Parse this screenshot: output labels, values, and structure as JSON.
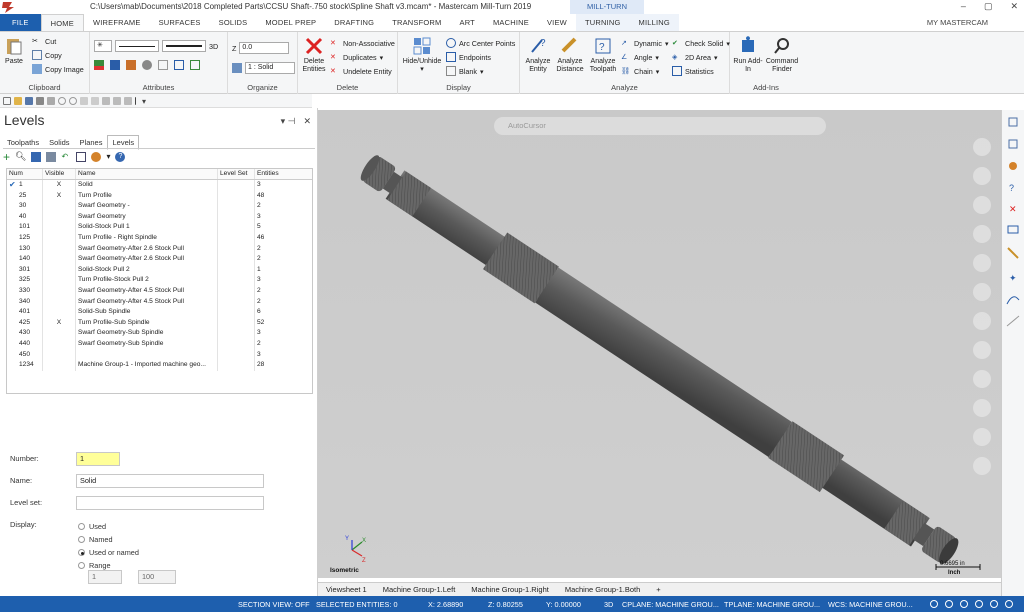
{
  "window": {
    "title": "C:\\Users\\mab\\Documents\\2018 Completed Parts\\CCSU Shaft-.750 stock\\Spline Shaft v3.mcam* - Mastercam Mill-Turn 2019",
    "context_tab": "MILL-TURN"
  },
  "tabs": [
    "FILE",
    "HOME",
    "WIREFRAME",
    "SURFACES",
    "SOLIDS",
    "MODEL PREP",
    "DRAFTING",
    "TRANSFORM",
    "ART",
    "MACHINE",
    "VIEW",
    "TURNING",
    "MILLING"
  ],
  "account": "MY MASTERCAM",
  "ribbon": {
    "clipboard": {
      "paste": "Paste",
      "cut": "Cut",
      "copy": "Copy",
      "copy_image": "Copy Image",
      "label": "Clipboard"
    },
    "attributes": {
      "label": "Attributes",
      "mode": "3D"
    },
    "organize": {
      "label": "Organize",
      "z_label": "Z",
      "z_value": "0.0",
      "level_value": "1 : Solid"
    },
    "delete": {
      "label": "Delete",
      "delete_entities": "Delete Entities",
      "non_assoc": "Non-Associative",
      "duplicates": "Duplicates",
      "undelete": "Undelete Entity"
    },
    "display": {
      "label": "Display",
      "hide": "Hide/Unhide",
      "arc_centers": "Arc Center Points",
      "endpoints": "Endpoints",
      "blank": "Blank"
    },
    "analyze": {
      "label": "Analyze",
      "entity": "Analyze Entity",
      "distance": "Analyze Distance",
      "toolpath": "Analyze Toolpath",
      "dynamic": "Dynamic",
      "angle": "Angle",
      "chain": "Chain",
      "check_solid": "Check Solid",
      "area_2d": "2D Area",
      "statistics": "Statistics"
    },
    "addins": {
      "label": "Add-Ins",
      "run": "Run Add-In",
      "finder": "Command Finder"
    }
  },
  "panel": {
    "title": "Levels",
    "tabs": [
      "Toolpaths",
      "Solids",
      "Planes",
      "Levels"
    ],
    "columns": [
      "Num",
      "Visible",
      "Name",
      "Level Set",
      "Entities"
    ],
    "rows": [
      {
        "num": "1",
        "visible": "X",
        "name": "Solid",
        "set": "",
        "entities": "3",
        "check": "✔"
      },
      {
        "num": "25",
        "visible": "X",
        "name": "Turn Profile",
        "set": "",
        "entities": "48",
        "check": ""
      },
      {
        "num": "30",
        "visible": "",
        "name": "Swarf Geometry -",
        "set": "",
        "entities": "2",
        "check": ""
      },
      {
        "num": "40",
        "visible": "",
        "name": "Swarf Geometry",
        "set": "",
        "entities": "3",
        "check": ""
      },
      {
        "num": "101",
        "visible": "",
        "name": "Solid-Stock Pull 1",
        "set": "",
        "entities": "5",
        "check": ""
      },
      {
        "num": "125",
        "visible": "",
        "name": "Turn Profile - Right Spindle",
        "set": "",
        "entities": "46",
        "check": ""
      },
      {
        "num": "130",
        "visible": "",
        "name": "Swarf Geometry-After 2.6 Stock Pull",
        "set": "",
        "entities": "2",
        "check": ""
      },
      {
        "num": "140",
        "visible": "",
        "name": "Swarf Geometry-After 2.6 Stock Pull",
        "set": "",
        "entities": "2",
        "check": ""
      },
      {
        "num": "301",
        "visible": "",
        "name": "Solid-Stock Pull 2",
        "set": "",
        "entities": "1",
        "check": ""
      },
      {
        "num": "325",
        "visible": "",
        "name": "Turn Profile-Stock Pull 2",
        "set": "",
        "entities": "3",
        "check": ""
      },
      {
        "num": "330",
        "visible": "",
        "name": "Swarf Geometry-After 4.5 Stock Pull",
        "set": "",
        "entities": "2",
        "check": ""
      },
      {
        "num": "340",
        "visible": "",
        "name": "Swarf Geometry-After 4.5 Stock Pull",
        "set": "",
        "entities": "2",
        "check": ""
      },
      {
        "num": "401",
        "visible": "",
        "name": "Solid-Sub Spindle",
        "set": "",
        "entities": "6",
        "check": ""
      },
      {
        "num": "425",
        "visible": "X",
        "name": "Turn Profile-Sub Spindle",
        "set": "",
        "entities": "52",
        "check": ""
      },
      {
        "num": "430",
        "visible": "",
        "name": "Swarf Geometry-Sub Spindle",
        "set": "",
        "entities": "3",
        "check": ""
      },
      {
        "num": "440",
        "visible": "",
        "name": "Swarf Geometry-Sub Spindle",
        "set": "",
        "entities": "2",
        "check": ""
      },
      {
        "num": "450",
        "visible": "",
        "name": "",
        "set": "",
        "entities": "3",
        "check": ""
      },
      {
        "num": "1234",
        "visible": "",
        "name": "Machine Group-1 - Imported machine geo...",
        "set": "",
        "entities": "28",
        "check": ""
      }
    ],
    "props": {
      "number_label": "Number:",
      "number_value": "1",
      "name_label": "Name:",
      "name_value": "Solid",
      "levelset_label": "Level set:",
      "levelset_value": "",
      "display_label": "Display:",
      "options": [
        "Used",
        "Named",
        "Used or named",
        "Range"
      ],
      "selected": "Used or named",
      "range_from": "1",
      "range_to": "100"
    }
  },
  "viewport": {
    "autocursor": "AutoCursor",
    "view_name": "Isometric",
    "scale_value": "0.6695 in",
    "scale_unit": "Inch",
    "axis_x": "X",
    "axis_y": "Y",
    "axis_z": "Z"
  },
  "sheets": [
    "Viewsheet 1",
    "Machine Group-1.Left",
    "Machine Group-1.Right",
    "Machine Group-1.Both",
    "+"
  ],
  "status": {
    "section_view": "SECTION VIEW: OFF",
    "selected": "SELECTED ENTITIES: 0",
    "x": "X:  2.68890",
    "z": "Z:  0.80255",
    "y": "Y:  0.00000",
    "mode": "3D",
    "cplane": "CPLANE: MACHINE GROU...",
    "tplane": "TPLANE: MACHINE GROU...",
    "wcs": "WCS: MACHINE GROU..."
  },
  "colors": {
    "accent": "#1d5fae",
    "shaft": "#5a5a5a",
    "viewport_bg": "#cbcbcb"
  }
}
